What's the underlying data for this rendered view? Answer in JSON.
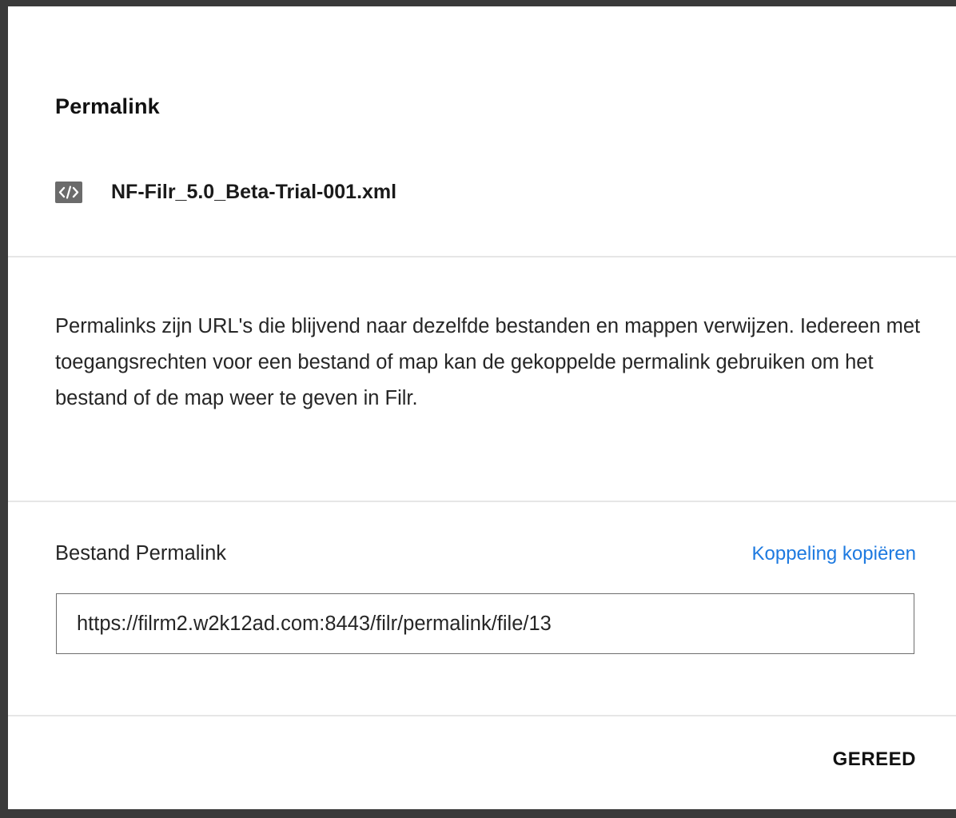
{
  "dialog": {
    "title": "Permalink",
    "file": {
      "icon": "xml-code-file-icon",
      "name": "NF-Filr_5.0_Beta-Trial-001.xml"
    },
    "description": "Permalinks zijn URL's die blijvend naar dezelfde bestanden en mappen verwijzen. Iedereen met toegangsrechten voor een bestand of map kan de gekoppelde permalink gebruiken om het bestand of de map weer te geven in Filr.",
    "permalink": {
      "label": "Bestand Permalink",
      "copy_label": "Koppeling kopiëren",
      "value": "https://filrm2.w2k12ad.com:8443/filr/permalink/file/13"
    },
    "done_label": "GEREED"
  },
  "colors": {
    "link": "#1e7ae0",
    "divider": "#e6e6e6",
    "icon_bg": "#6b6b6b"
  }
}
